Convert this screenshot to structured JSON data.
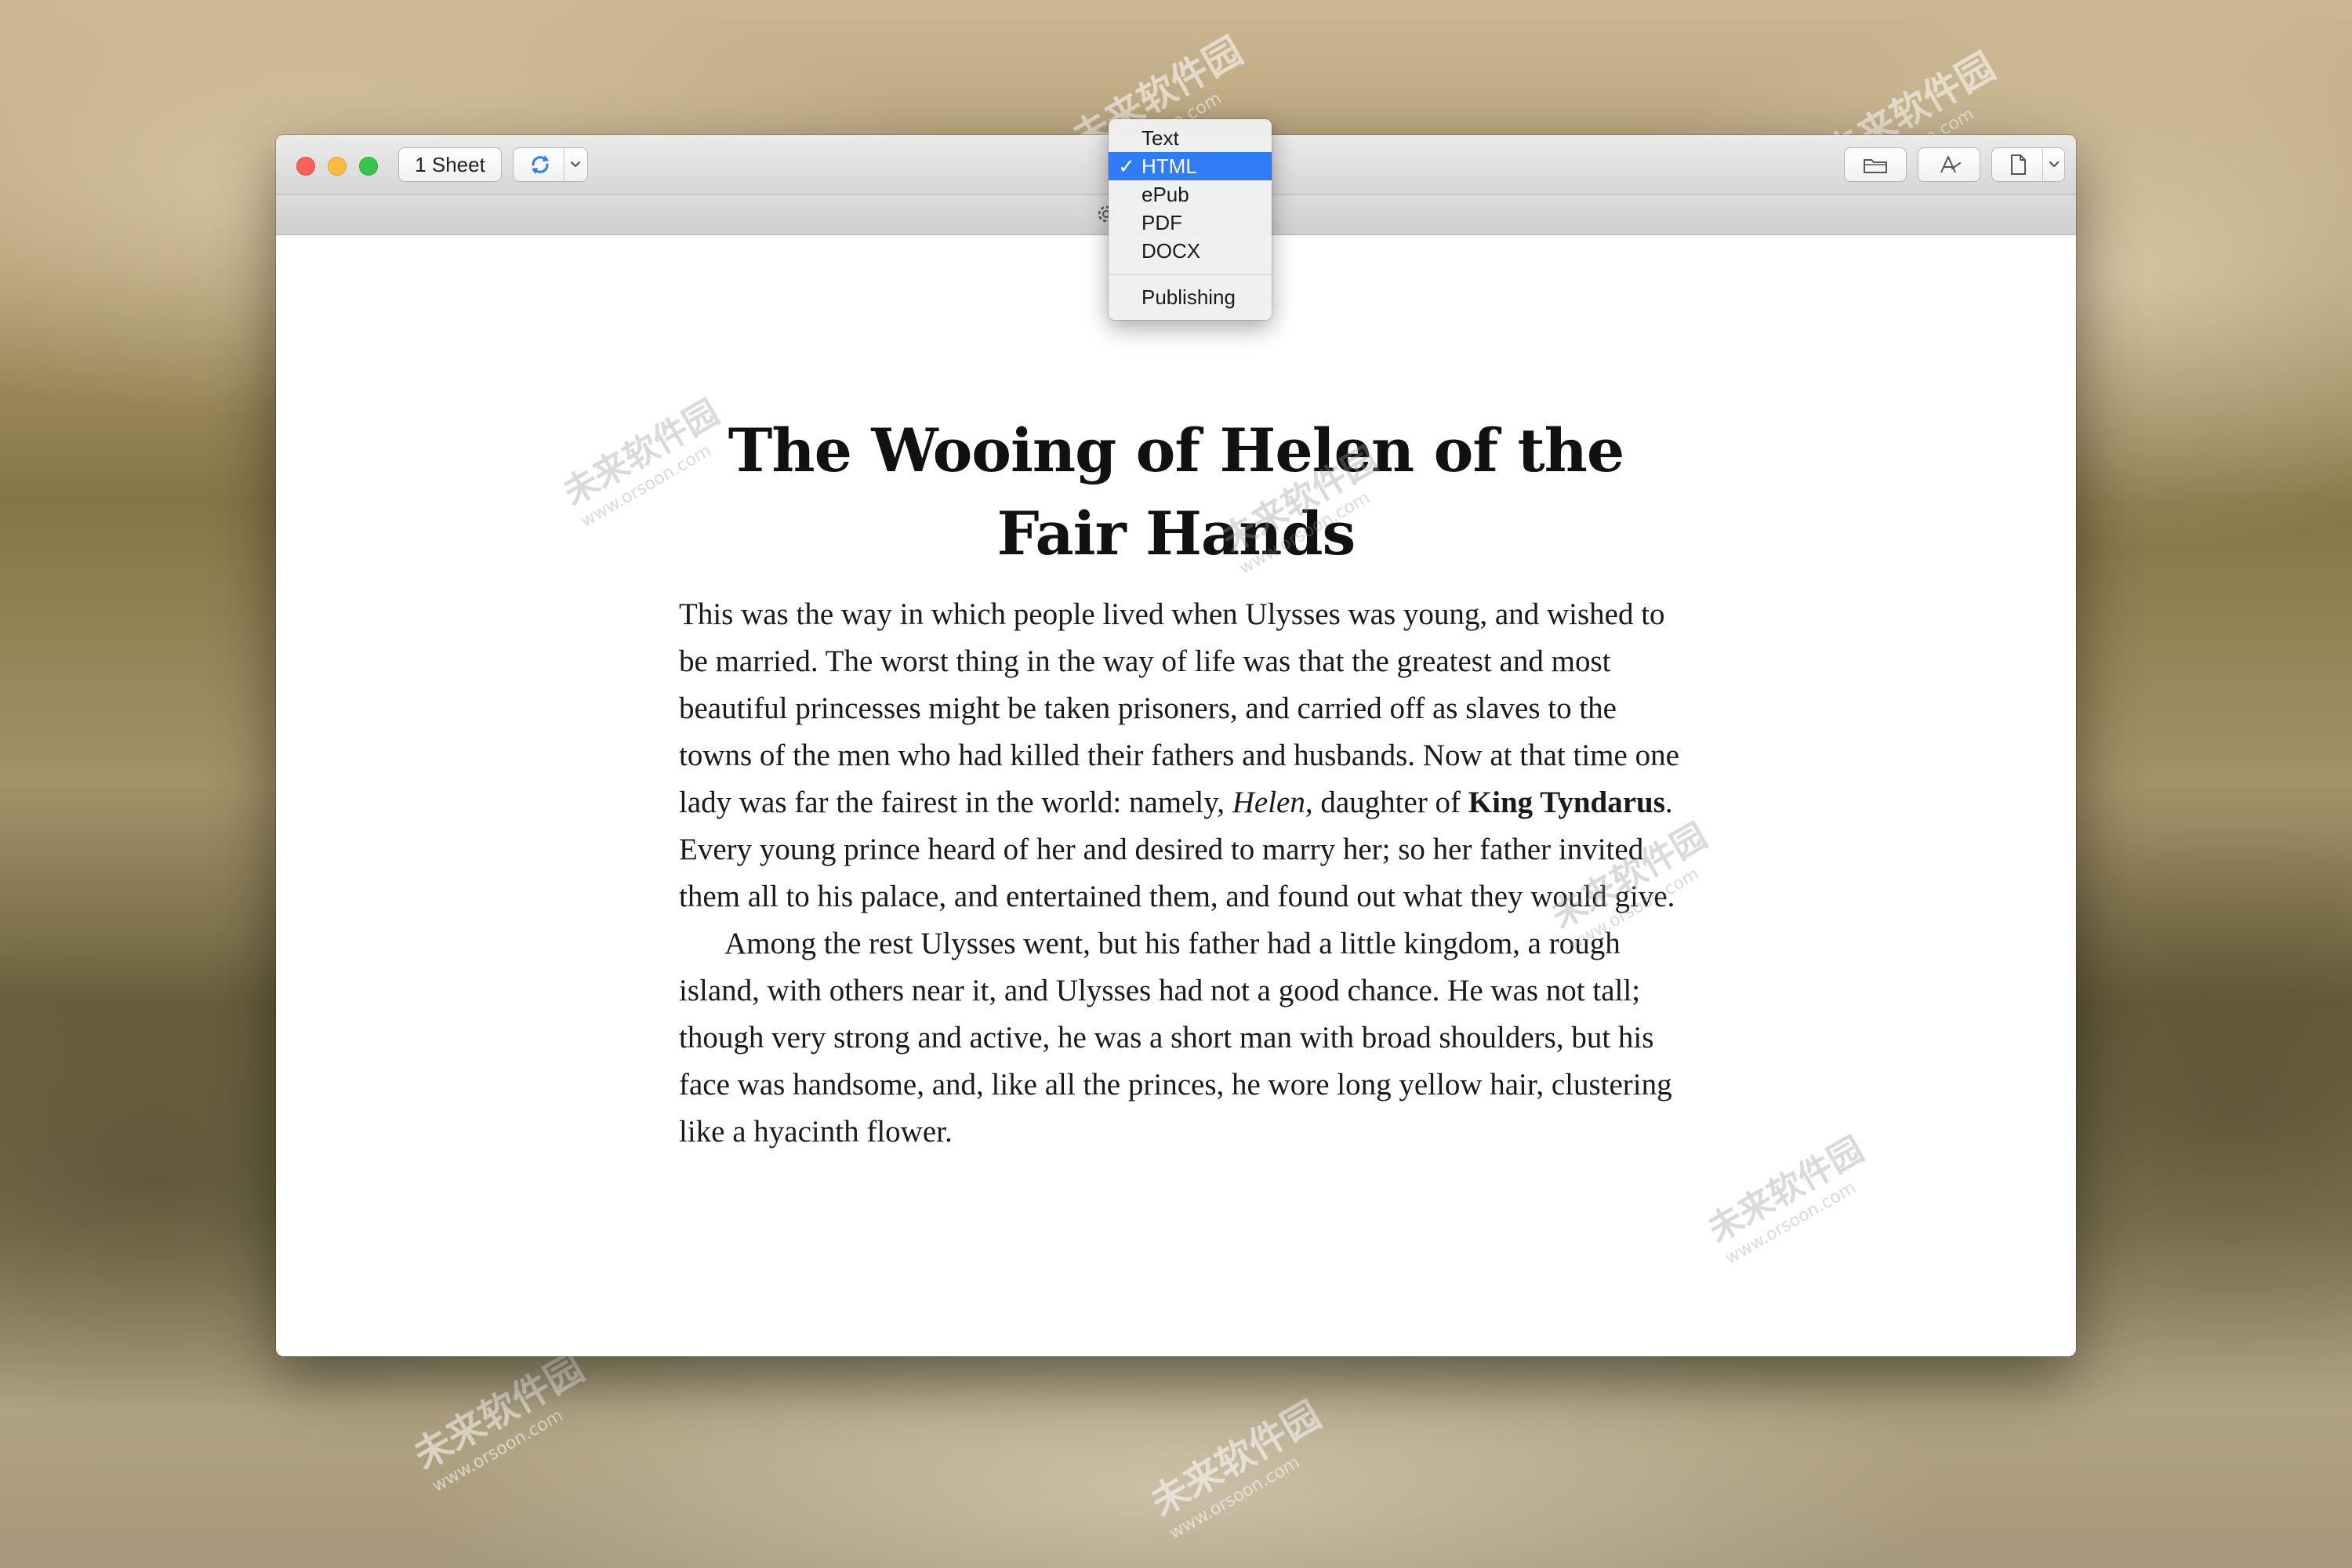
{
  "toolbar": {
    "sheet_count_label": "1 Sheet"
  },
  "export_menu": {
    "items": [
      {
        "label": "Text",
        "selected": false
      },
      {
        "label": "HTML",
        "selected": true
      },
      {
        "label": "ePub",
        "selected": false
      },
      {
        "label": "PDF",
        "selected": false
      },
      {
        "label": "DOCX",
        "selected": false
      }
    ],
    "check_mark": "✓",
    "footer_item": "Publishing"
  },
  "document": {
    "title": "The Wooing of Helen of the Fair Hands",
    "p1_before_italic": "This was the way in which people lived when Ulysses was young, and wished to be married. The worst thing in the way of life was that the greatest and most beautiful princesses might be taken prisoners, and carried off as slaves to the towns of the men who had killed their fathers and husbands. Now at that time one lady was far the fairest in the world: namely, ",
    "p1_italic": "Helen",
    "p1_between": ", daughter of ",
    "p1_bold": "King Tyndarus",
    "p1_after": ". Every young prince heard of her and desired to marry her; so her father invited them all to his palace, and entertained them, and found out what they would give.",
    "p2": "Among the rest Ulysses went, but his father had a little kingdom, a rough island, with others near it, and Ulysses had not a good chance. He was not tall; though very strong and active, he was a short man with broad shoulders, but his face was handsome, and, like all the princes, he wore long yellow hair, clustering like a hyacinth flower."
  },
  "watermark": {
    "brand": "未来软件园",
    "url": "www.orsoon.com"
  },
  "colors": {
    "selection_blue": "#2f7cf6",
    "close": "#fc605c",
    "minimize": "#fdbc40",
    "maximize": "#34c84a"
  }
}
